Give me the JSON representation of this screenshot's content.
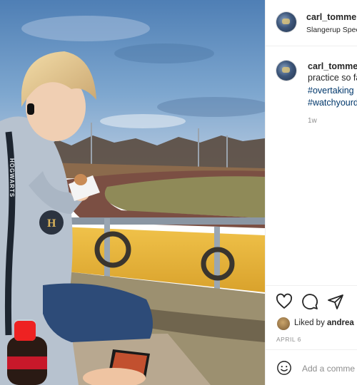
{
  "post": {
    "username": "carl_tommer",
    "location": "Slangerup Spee"
  },
  "comment": {
    "username": "carl_tommer",
    "text": "practice so fa",
    "hashtags": [
      "#overtaking",
      "#watchyourd"
    ],
    "time": "1w"
  },
  "actions": {
    "liked_prefix": "Liked by ",
    "liked_user": "andrea",
    "date": "APRIL 6"
  },
  "add_comment": {
    "placeholder": "Add a comme"
  },
  "photo": {
    "jersey_text": "HOGWARTS"
  },
  "colors": {
    "link": "#00376b",
    "muted": "#8e8e8e",
    "sky": "#5a86b8",
    "fence": "#e4b43a"
  }
}
